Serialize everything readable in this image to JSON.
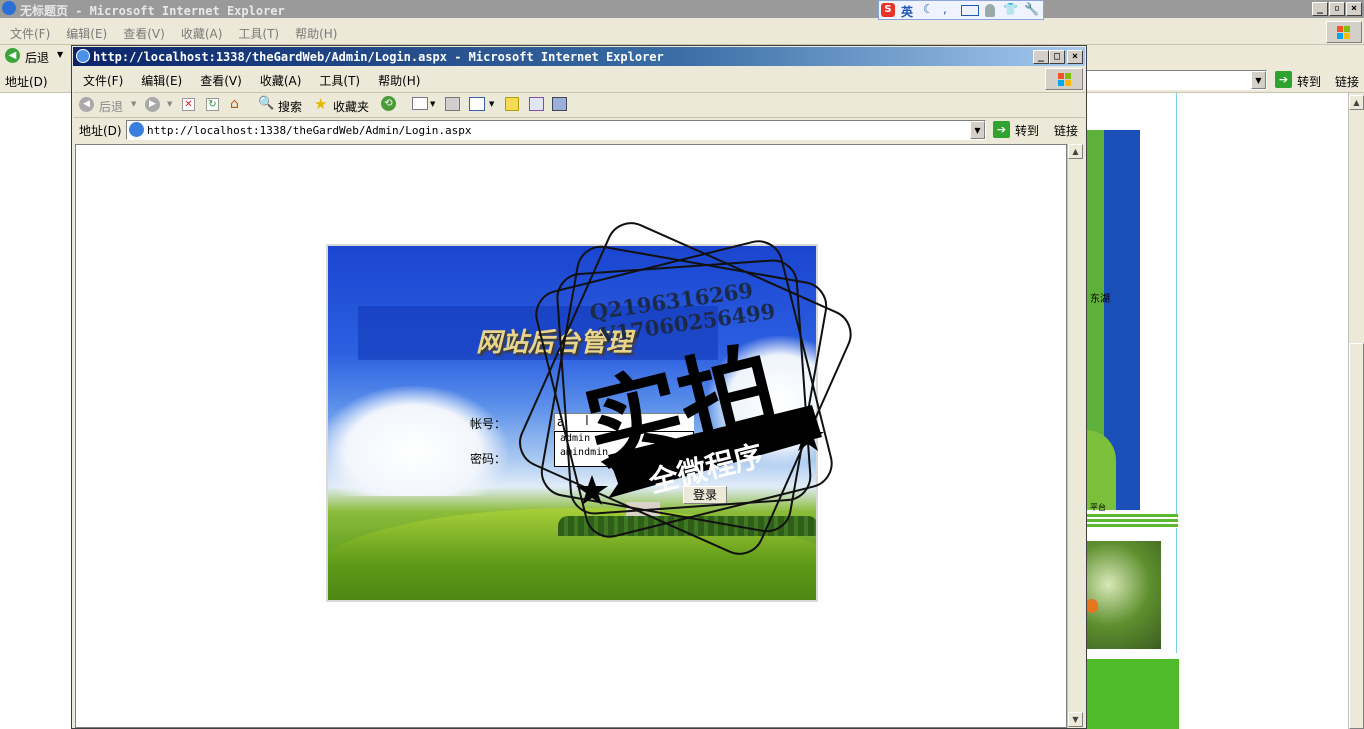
{
  "outer_window": {
    "title": "无标题页 - Microsoft Internet Explorer",
    "menu": [
      "文件(F)",
      "编辑(E)",
      "查看(V)",
      "收藏(A)",
      "工具(T)",
      "帮助(H)"
    ],
    "back_label": "后退",
    "address_label": "地址(D)",
    "go_label": "转到",
    "links_label": "链接"
  },
  "ime_bar": {
    "lang": "英"
  },
  "inner_window": {
    "title": "http://localhost:1338/theGardWeb/Admin/Login.aspx - Microsoft Internet Explorer",
    "menu": [
      "文件(F)",
      "编辑(E)",
      "查看(V)",
      "收藏(A)",
      "工具(T)",
      "帮助(H)"
    ],
    "toolbar": {
      "back": "后退",
      "search": "搜索",
      "favorites": "收藏夹"
    },
    "address_label": "地址(D)",
    "url": "http://localhost:1338/theGardWeb/Admin/Login.aspx",
    "go_label": "转到",
    "links_label": "链接"
  },
  "login": {
    "heading": "网站后台管理",
    "account_label": "帐号：",
    "password_label": "密码：",
    "account_value": "a",
    "autocomplete": [
      "admin",
      "amindmin"
    ],
    "submit_label": "登录"
  },
  "watermark": {
    "qq": "Q2196316269",
    "phone": "V17060256499",
    "main": "实拍",
    "banner": "全微程序"
  },
  "background_page": {
    "label1": "东湖",
    "label2": "平台"
  },
  "colors": {
    "sky": "#1f4fd6",
    "grass": "#6aa81e",
    "title_gold": "#e8d48a"
  }
}
